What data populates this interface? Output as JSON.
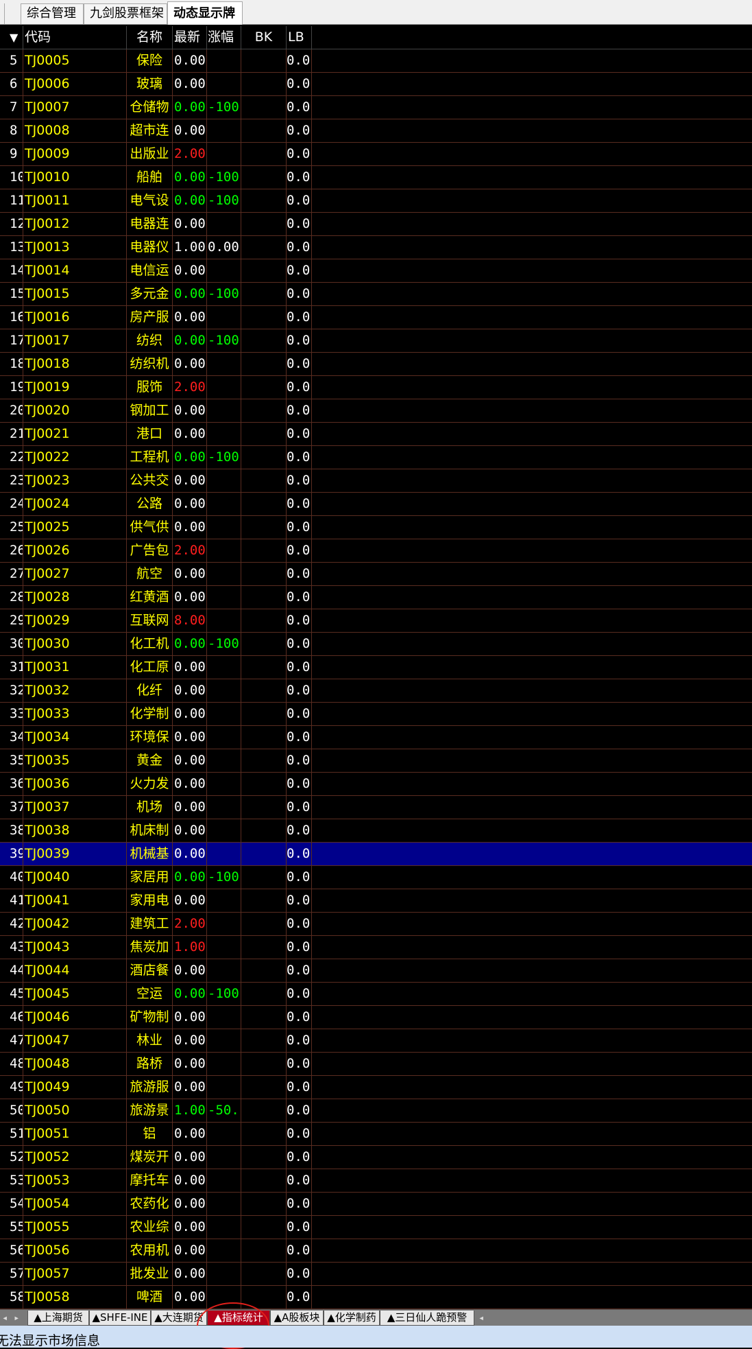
{
  "tabs": [
    {
      "label": "综合管理",
      "active": false
    },
    {
      "label": "九剑股票框架",
      "active": false
    },
    {
      "label": "动态显示牌",
      "active": true
    }
  ],
  "columns": {
    "sort_icon": "▼",
    "code": "代码",
    "name": "名称",
    "last": "最新",
    "change": "涨幅",
    "bk": "BK",
    "lb": "LB"
  },
  "rows": [
    {
      "idx": "5",
      "code": "TJ0005",
      "name": "保险",
      "last": "0.00",
      "change": "",
      "lb": "0.0"
    },
    {
      "idx": "6",
      "code": "TJ0006",
      "name": "玻璃",
      "last": "0.00",
      "change": "",
      "lb": "0.0"
    },
    {
      "idx": "7",
      "code": "TJ0007",
      "name": "仓储物",
      "last": "0.00",
      "change": "-100",
      "lb": "0.0",
      "color": "green"
    },
    {
      "idx": "8",
      "code": "TJ0008",
      "name": "超市连",
      "last": "0.00",
      "change": "",
      "lb": "0.0"
    },
    {
      "idx": "9",
      "code": "TJ0009",
      "name": "出版业",
      "last": "2.00",
      "change": "",
      "lb": "0.0",
      "color": "red"
    },
    {
      "idx": "10",
      "code": "TJ0010",
      "name": "船舶",
      "last": "0.00",
      "change": "-100",
      "lb": "0.0",
      "color": "green"
    },
    {
      "idx": "11",
      "code": "TJ0011",
      "name": "电气设",
      "last": "0.00",
      "change": "-100",
      "lb": "0.0",
      "color": "green"
    },
    {
      "idx": "12",
      "code": "TJ0012",
      "name": "电器连",
      "last": "0.00",
      "change": "",
      "lb": "0.0"
    },
    {
      "idx": "13",
      "code": "TJ0013",
      "name": "电器仪",
      "last": "1.00",
      "change": "0.00",
      "lb": "0.0"
    },
    {
      "idx": "14",
      "code": "TJ0014",
      "name": "电信运",
      "last": "0.00",
      "change": "",
      "lb": "0.0"
    },
    {
      "idx": "15",
      "code": "TJ0015",
      "name": "多元金",
      "last": "0.00",
      "change": "-100",
      "lb": "0.0",
      "color": "green"
    },
    {
      "idx": "16",
      "code": "TJ0016",
      "name": "房产服",
      "last": "0.00",
      "change": "",
      "lb": "0.0"
    },
    {
      "idx": "17",
      "code": "TJ0017",
      "name": "纺织",
      "last": "0.00",
      "change": "-100",
      "lb": "0.0",
      "color": "green"
    },
    {
      "idx": "18",
      "code": "TJ0018",
      "name": "纺织机",
      "last": "0.00",
      "change": "",
      "lb": "0.0"
    },
    {
      "idx": "19",
      "code": "TJ0019",
      "name": "服饰",
      "last": "2.00",
      "change": "",
      "lb": "0.0",
      "color": "red"
    },
    {
      "idx": "20",
      "code": "TJ0020",
      "name": "钢加工",
      "last": "0.00",
      "change": "",
      "lb": "0.0"
    },
    {
      "idx": "21",
      "code": "TJ0021",
      "name": "港口",
      "last": "0.00",
      "change": "",
      "lb": "0.0"
    },
    {
      "idx": "22",
      "code": "TJ0022",
      "name": "工程机",
      "last": "0.00",
      "change": "-100",
      "lb": "0.0",
      "color": "green"
    },
    {
      "idx": "23",
      "code": "TJ0023",
      "name": "公共交",
      "last": "0.00",
      "change": "",
      "lb": "0.0"
    },
    {
      "idx": "24",
      "code": "TJ0024",
      "name": "公路",
      "last": "0.00",
      "change": "",
      "lb": "0.0"
    },
    {
      "idx": "25",
      "code": "TJ0025",
      "name": "供气供",
      "last": "0.00",
      "change": "",
      "lb": "0.0"
    },
    {
      "idx": "26",
      "code": "TJ0026",
      "name": "广告包",
      "last": "2.00",
      "change": "",
      "lb": "0.0",
      "color": "red"
    },
    {
      "idx": "27",
      "code": "TJ0027",
      "name": "航空",
      "last": "0.00",
      "change": "",
      "lb": "0.0"
    },
    {
      "idx": "28",
      "code": "TJ0028",
      "name": "红黄酒",
      "last": "0.00",
      "change": "",
      "lb": "0.0"
    },
    {
      "idx": "29",
      "code": "TJ0029",
      "name": "互联网",
      "last": "8.00",
      "change": "",
      "lb": "0.0",
      "color": "red"
    },
    {
      "idx": "30",
      "code": "TJ0030",
      "name": "化工机",
      "last": "0.00",
      "change": "-100",
      "lb": "0.0",
      "color": "green"
    },
    {
      "idx": "31",
      "code": "TJ0031",
      "name": "化工原",
      "last": "0.00",
      "change": "",
      "lb": "0.0"
    },
    {
      "idx": "32",
      "code": "TJ0032",
      "name": "化纤",
      "last": "0.00",
      "change": "",
      "lb": "0.0"
    },
    {
      "idx": "33",
      "code": "TJ0033",
      "name": "化学制",
      "last": "0.00",
      "change": "",
      "lb": "0.0"
    },
    {
      "idx": "34",
      "code": "TJ0034",
      "name": "环境保",
      "last": "0.00",
      "change": "",
      "lb": "0.0"
    },
    {
      "idx": "35",
      "code": "TJ0035",
      "name": "黄金",
      "last": "0.00",
      "change": "",
      "lb": "0.0"
    },
    {
      "idx": "36",
      "code": "TJ0036",
      "name": "火力发",
      "last": "0.00",
      "change": "",
      "lb": "0.0"
    },
    {
      "idx": "37",
      "code": "TJ0037",
      "name": "机场",
      "last": "0.00",
      "change": "",
      "lb": "0.0"
    },
    {
      "idx": "38",
      "code": "TJ0038",
      "name": "机床制",
      "last": "0.00",
      "change": "",
      "lb": "0.0"
    },
    {
      "idx": "39",
      "code": "TJ0039",
      "name": "机械基",
      "last": "0.00",
      "change": "",
      "lb": "0.0",
      "selected": true
    },
    {
      "idx": "40",
      "code": "TJ0040",
      "name": "家居用",
      "last": "0.00",
      "change": "-100",
      "lb": "0.0",
      "color": "green"
    },
    {
      "idx": "41",
      "code": "TJ0041",
      "name": "家用电",
      "last": "0.00",
      "change": "",
      "lb": "0.0"
    },
    {
      "idx": "42",
      "code": "TJ0042",
      "name": "建筑工",
      "last": "2.00",
      "change": "",
      "lb": "0.0",
      "color": "red"
    },
    {
      "idx": "43",
      "code": "TJ0043",
      "name": "焦炭加",
      "last": "1.00",
      "change": "",
      "lb": "0.0",
      "color": "red"
    },
    {
      "idx": "44",
      "code": "TJ0044",
      "name": "酒店餐",
      "last": "0.00",
      "change": "",
      "lb": "0.0"
    },
    {
      "idx": "45",
      "code": "TJ0045",
      "name": "空运",
      "last": "0.00",
      "change": "-100",
      "lb": "0.0",
      "color": "green"
    },
    {
      "idx": "46",
      "code": "TJ0046",
      "name": "矿物制",
      "last": "0.00",
      "change": "",
      "lb": "0.0"
    },
    {
      "idx": "47",
      "code": "TJ0047",
      "name": "林业",
      "last": "0.00",
      "change": "",
      "lb": "0.0"
    },
    {
      "idx": "48",
      "code": "TJ0048",
      "name": "路桥",
      "last": "0.00",
      "change": "",
      "lb": "0.0"
    },
    {
      "idx": "49",
      "code": "TJ0049",
      "name": "旅游服",
      "last": "0.00",
      "change": "",
      "lb": "0.0"
    },
    {
      "idx": "50",
      "code": "TJ0050",
      "name": "旅游景",
      "last": "1.00",
      "change": "-50.",
      "lb": "0.0",
      "color": "green"
    },
    {
      "idx": "51",
      "code": "TJ0051",
      "name": "铝",
      "last": "0.00",
      "change": "",
      "lb": "0.0"
    },
    {
      "idx": "52",
      "code": "TJ0052",
      "name": "煤炭开",
      "last": "0.00",
      "change": "",
      "lb": "0.0"
    },
    {
      "idx": "53",
      "code": "TJ0053",
      "name": "摩托车",
      "last": "0.00",
      "change": "",
      "lb": "0.0"
    },
    {
      "idx": "54",
      "code": "TJ0054",
      "name": "农药化",
      "last": "0.00",
      "change": "",
      "lb": "0.0"
    },
    {
      "idx": "55",
      "code": "TJ0055",
      "name": "农业综",
      "last": "0.00",
      "change": "",
      "lb": "0.0"
    },
    {
      "idx": "56",
      "code": "TJ0056",
      "name": "农用机",
      "last": "0.00",
      "change": "",
      "lb": "0.0"
    },
    {
      "idx": "57",
      "code": "TJ0057",
      "name": "批发业",
      "last": "0.00",
      "change": "",
      "lb": "0.0"
    },
    {
      "idx": "58",
      "code": "TJ0058",
      "name": "啤酒",
      "last": "0.00",
      "change": "",
      "lb": "0.0"
    }
  ],
  "sheet_tabs": [
    {
      "label": "▲上海期货",
      "active": false
    },
    {
      "label": "▲SHFE-INE",
      "active": false
    },
    {
      "label": "▲大连期货",
      "active": false
    },
    {
      "label": "▲指标统计",
      "active": true
    },
    {
      "label": "▲A股板块",
      "active": false
    },
    {
      "label": "▲化学制药",
      "active": false
    },
    {
      "label": "▲三日仙人跪预警",
      "active": false
    }
  ],
  "status": "无法显示市场信息",
  "colors": {
    "up": "#ff1e1e",
    "down": "#00ff00",
    "flat": "#ffffff",
    "code_name": "#ffff00",
    "selected_row": "#00008b",
    "active_sheet_tab": "#b5001a",
    "annotation": "#e0201a"
  }
}
